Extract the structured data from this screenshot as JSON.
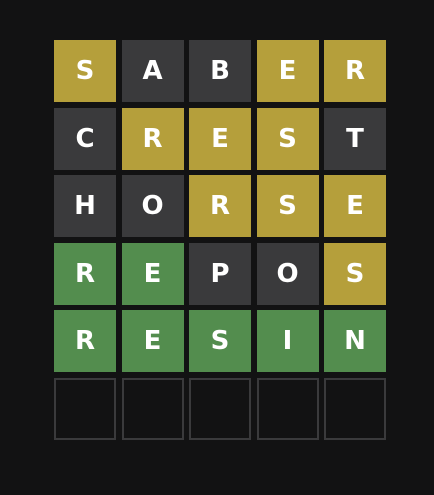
{
  "colors": {
    "background": "#121213",
    "present": "#b59f3b",
    "absent": "#3a3a3c",
    "correct": "#538d4e",
    "empty_border": "#3a3a3c",
    "text": "#ffffff"
  },
  "board": {
    "rows": [
      {
        "letters": [
          "S",
          "A",
          "B",
          "E",
          "R"
        ],
        "states": [
          "present",
          "absent",
          "absent",
          "present",
          "present"
        ]
      },
      {
        "letters": [
          "C",
          "R",
          "E",
          "S",
          "T"
        ],
        "states": [
          "absent",
          "present",
          "present",
          "present",
          "absent"
        ]
      },
      {
        "letters": [
          "H",
          "O",
          "R",
          "S",
          "E"
        ],
        "states": [
          "absent",
          "absent",
          "present",
          "present",
          "present"
        ]
      },
      {
        "letters": [
          "R",
          "E",
          "P",
          "O",
          "S"
        ],
        "states": [
          "correct",
          "correct",
          "absent",
          "absent",
          "present"
        ]
      },
      {
        "letters": [
          "R",
          "E",
          "S",
          "I",
          "N"
        ],
        "states": [
          "correct",
          "correct",
          "correct",
          "correct",
          "correct"
        ]
      },
      {
        "letters": [
          "",
          "",
          "",
          "",
          ""
        ],
        "states": [
          "empty",
          "empty",
          "empty",
          "empty",
          "empty"
        ]
      }
    ]
  }
}
